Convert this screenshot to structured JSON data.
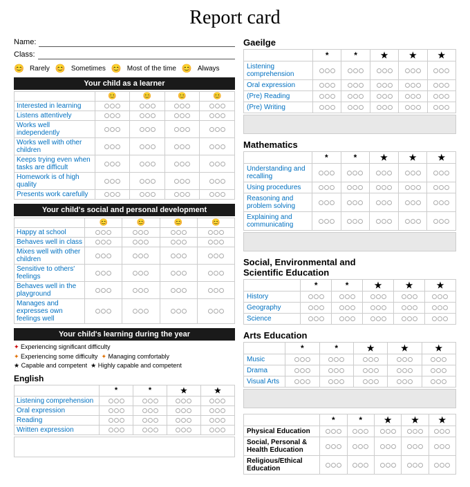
{
  "title": "Report card",
  "left": {
    "name_label": "Name:",
    "class_label": "Class:",
    "legend": [
      {
        "icon": "😊",
        "label": "Rarely"
      },
      {
        "icon": "😊",
        "label": "Sometimes"
      },
      {
        "icon": "😊",
        "label": "Most of the time"
      },
      {
        "icon": "😊",
        "label": "Always"
      }
    ],
    "section1_title": "Your child as a learner",
    "section1_headers": [
      "😊",
      "😊",
      "😊",
      "😊"
    ],
    "section1_rows": [
      "Interested in learning",
      "Listens attentively",
      "Works well independently",
      "Works well with other children",
      "Keeps trying even when tasks are difficult",
      "Homework is of high quality",
      "Presents work carefully"
    ],
    "section2_title": "Your child's social and personal development",
    "section2_headers": [
      "😊",
      "😊",
      "😊",
      "😊"
    ],
    "section2_rows": [
      "Happy at school",
      "Behaves well in class",
      "Mixes well with other children",
      "Sensitive to others' feelings",
      "Behaves well in the playground",
      "Manages and expresses own feelings well"
    ],
    "year_title": "Your child's learning during the year",
    "year_legend": [
      "✦ Experiencing significant difficulty",
      "✦ Experiencing some difficulty  ✦ Managing comfortably",
      "★ Capable and competent  ★ Highly capable and competent"
    ],
    "english_title": "English",
    "english_headers": [
      "*",
      "*",
      "★",
      "★"
    ],
    "english_rows": [
      "Listening comprehension",
      "Oral expression",
      "Reading",
      "Written expression"
    ]
  },
  "right": {
    "gaeilge": {
      "title": "Gaeilge",
      "headers": [
        "*",
        "*",
        "★",
        "★",
        "★"
      ],
      "rows": [
        "Listening comprehension",
        "Oral expression",
        "(Pre) Reading",
        "(Pre) Writing"
      ]
    },
    "maths": {
      "title": "Mathematics",
      "headers": [
        "*",
        "*",
        "★",
        "★",
        "★"
      ],
      "rows": [
        "Understanding and recalling",
        "Using procedures",
        "Reasoning and problem solving",
        "Explaining and communicating"
      ]
    },
    "sese": {
      "title": "Social, Environmental and\nScientific Education",
      "headers": [
        "*",
        "*",
        "★",
        "★",
        "★"
      ],
      "rows": [
        "History",
        "Geography",
        "Science"
      ]
    },
    "arts": {
      "title": "Arts Education",
      "headers": [
        "*",
        "*",
        "★",
        "★",
        "★"
      ],
      "rows": [
        "Music",
        "Drama",
        "Visual Arts"
      ]
    },
    "physical": {
      "headers": [
        "*",
        "*",
        "★",
        "★",
        "★"
      ],
      "rows": [
        "Physical Education",
        "Social, Personal & Health Education",
        "Religious/Ethical Education"
      ]
    }
  }
}
